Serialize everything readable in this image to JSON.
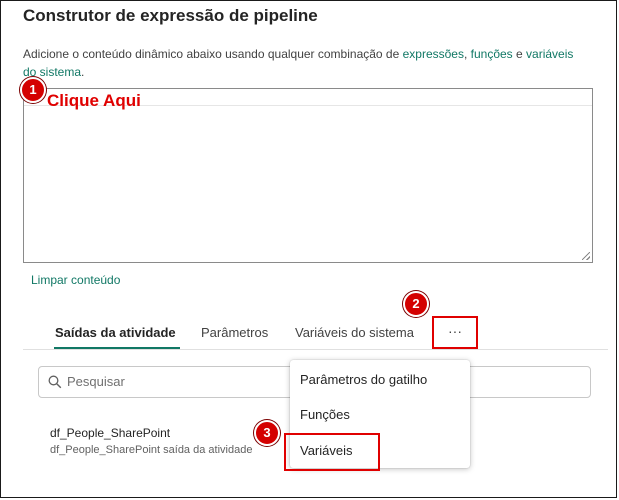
{
  "dialog": {
    "title": "Construtor de expressão de pipeline",
    "description_prefix": "Adicione o conteúdo dinâmico abaixo usando qualquer combinação de ",
    "link_expressions": "expressões",
    "sep1": ", ",
    "link_functions": "funções",
    "sep2": " e ",
    "link_system_vars": "variáveis do sistema",
    "end": ".",
    "clear_label": "Limpar conteúdo"
  },
  "annotations": {
    "badge1": "1",
    "click_here": "Clique Aqui",
    "badge2": "2",
    "badge3": "3",
    "color": "#e00000"
  },
  "tabs": [
    {
      "label": "Saídas da atividade",
      "active": true
    },
    {
      "label": "Parâmetros",
      "active": false
    },
    {
      "label": "Variáveis do sistema",
      "active": false
    }
  ],
  "more_label": "···",
  "search": {
    "placeholder": "Pesquisar"
  },
  "activity_item": {
    "name": "df_People_SharePoint",
    "subtitle": "df_People_SharePoint saída da atividade"
  },
  "menu": {
    "items": [
      "Parâmetros do gatilho",
      "Funções",
      "Variáveis"
    ]
  },
  "colors": {
    "accent": "#117865",
    "highlight": "#e00000"
  }
}
